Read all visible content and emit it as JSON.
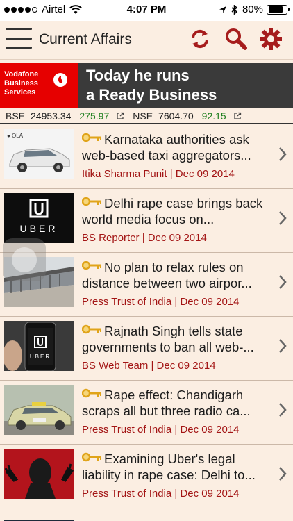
{
  "status_bar": {
    "carrier": "Airtel",
    "time": "4:07 PM",
    "battery": "80%",
    "battery_level": 0.8
  },
  "header": {
    "title": "Current Affairs",
    "icons": [
      "menu-icon",
      "refresh-icon",
      "search-icon",
      "gear-icon"
    ],
    "accent_color": "#a61c1c"
  },
  "ad": {
    "brand": "Vodafone Business Services",
    "line1": "Today he runs",
    "line2": "a Ready Business"
  },
  "ticker": {
    "bse_label": "BSE",
    "bse_value": "24953.34",
    "bse_change": "275.97",
    "nse_label": "NSE",
    "nse_value": "7604.70",
    "nse_change": "92.15"
  },
  "news": [
    {
      "headline": "Karnataka authorities ask web-based taxi aggregators...",
      "meta": "Itika Sharma Punit | Dec 09 2014",
      "thumb": "ola-car"
    },
    {
      "headline": "Delhi rape case brings back world media focus on...",
      "meta": "BS Reporter | Dec 09 2014",
      "thumb": "uber-logo"
    },
    {
      "headline": "No plan to relax rules on distance between two airpor...",
      "meta": "Press Trust of India | Dec 09 2014",
      "thumb": "airport"
    },
    {
      "headline": "Rajnath Singh tells state governments to ban all web-...",
      "meta": "BS Web Team | Dec 09 2014",
      "thumb": "uber-phone"
    },
    {
      "headline": "Rape effect: Chandigarh scraps all but three radio ca...",
      "meta": "Press Trust of India | Dec 09 2014",
      "thumb": "taxi"
    },
    {
      "headline": "Examining Uber's legal liability in rape case: Delhi to...",
      "meta": "Press Trust of India | Dec 09 2014",
      "thumb": "protest"
    }
  ]
}
